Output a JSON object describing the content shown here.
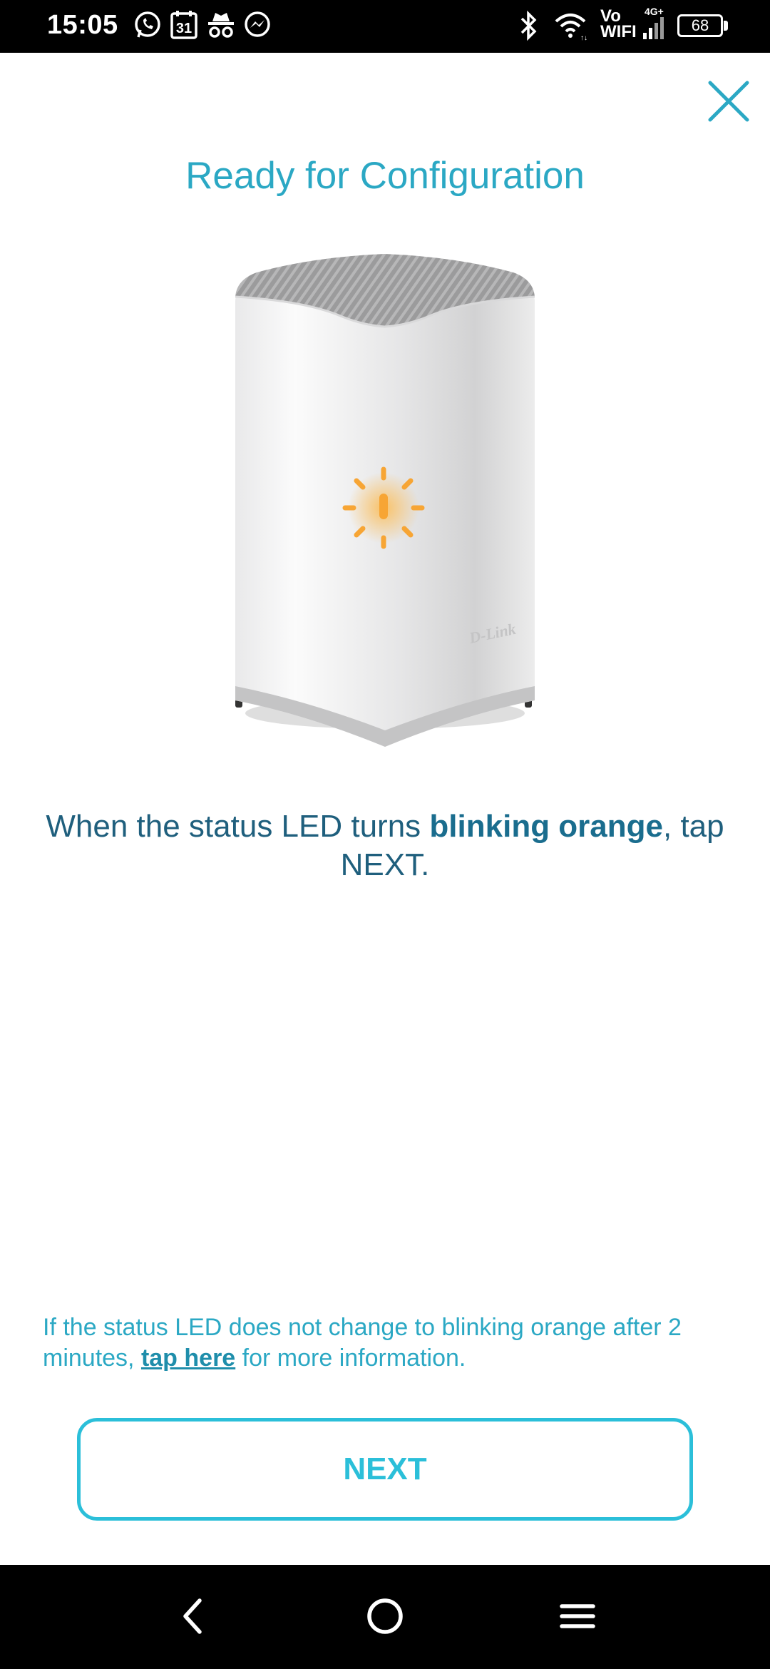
{
  "status_bar": {
    "time": "15:05",
    "calendar_day": "31",
    "vo_line1": "Vo",
    "vo_line2": "WIFI",
    "network": "4G+",
    "battery": "68",
    "icons": [
      "whatsapp-icon",
      "calendar-icon",
      "incognito-icon",
      "messenger-icon",
      "bluetooth-icon",
      "wifi-icon",
      "signal-icon",
      "battery-icon"
    ]
  },
  "header": {
    "title": "Ready for Configuration"
  },
  "device": {
    "brand": "D-Link"
  },
  "instruction": {
    "prefix": "When the status LED turns ",
    "emphasis": "blinking orange",
    "suffix": ", tap NEXT."
  },
  "help": {
    "prefix": "If the status LED does not change to blinking orange after 2 minutes, ",
    "link": "tap here",
    "suffix": " for more information."
  },
  "actions": {
    "next_label": "NEXT"
  },
  "colors": {
    "accent": "#2bbfd9",
    "title": "#2ba8c4",
    "body_text": "#1f5f7d",
    "led": "#f7a534"
  }
}
